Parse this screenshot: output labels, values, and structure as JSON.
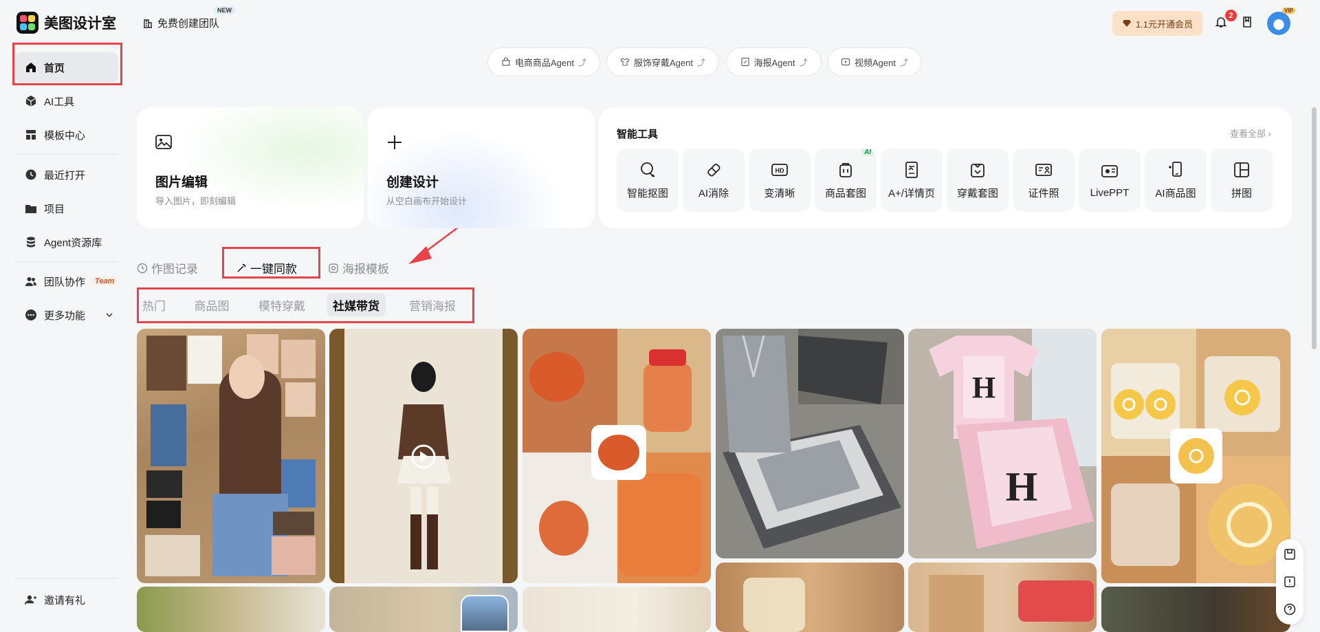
{
  "header": {
    "app_name": "美图设计室",
    "team_button": "免费创建团队",
    "new_badge": "NEW",
    "vip_button": "1.1元开通会员",
    "notification_count": "2",
    "avatar_badge": "VIP"
  },
  "sidebar": {
    "items": [
      {
        "label": "首页",
        "icon": "home-icon"
      },
      {
        "label": "AI工具",
        "icon": "cube-icon"
      },
      {
        "label": "模板中心",
        "icon": "layout-icon"
      },
      {
        "label": "最近打开",
        "icon": "clock-icon"
      },
      {
        "label": "项目",
        "icon": "folder-icon"
      },
      {
        "label": "Agent资源库",
        "icon": "database-icon"
      },
      {
        "label": "团队协作",
        "icon": "team-icon",
        "tag": "Team"
      },
      {
        "label": "更多功能",
        "icon": "more-icon"
      }
    ],
    "invite": "邀请有礼"
  },
  "agents": [
    {
      "label": "电商商品Agent",
      "icon": "bag-icon"
    },
    {
      "label": "服饰穿戴Agent",
      "icon": "shirt-icon"
    },
    {
      "label": "海报Agent",
      "icon": "poster-icon"
    },
    {
      "label": "视频Agent",
      "icon": "video-icon"
    }
  ],
  "cards": {
    "edit": {
      "title": "图片编辑",
      "subtitle": "导入图片，即刻编辑"
    },
    "create": {
      "title": "创建设计",
      "subtitle": "从空白画布开始设计"
    }
  },
  "tools": {
    "title": "智能工具",
    "view_all": "查看全部",
    "items": [
      {
        "label": "智能抠图",
        "icon": "cutout-icon"
      },
      {
        "label": "AI消除",
        "icon": "eraser-icon"
      },
      {
        "label": "变清晰",
        "icon": "hd-icon"
      },
      {
        "label": "商品套图",
        "icon": "product-set-icon",
        "tag": "AI"
      },
      {
        "label": "A+/详情页",
        "icon": "detail-page-icon"
      },
      {
        "label": "穿戴套图",
        "icon": "wear-set-icon"
      },
      {
        "label": "证件照",
        "icon": "id-photo-icon"
      },
      {
        "label": "LivePPT",
        "icon": "ppt-icon"
      },
      {
        "label": "AI商品图",
        "icon": "ai-product-icon"
      },
      {
        "label": "拼图",
        "icon": "collage-icon"
      }
    ]
  },
  "tabs": [
    {
      "label": "作图记录",
      "icon": "history-icon"
    },
    {
      "label": "一键同款",
      "icon": "magic-wand-icon",
      "active": true
    },
    {
      "label": "海报模板",
      "icon": "poster-template-icon"
    }
  ],
  "subtabs": [
    {
      "label": "热门"
    },
    {
      "label": "商品图"
    },
    {
      "label": "模特穿戴"
    },
    {
      "label": "社媒带货",
      "active": true
    },
    {
      "label": "营销海报"
    }
  ],
  "colors": {
    "accent_red": "#e8434c",
    "vip_bg": "#fde0c8",
    "ai_tag": "#1b8a4e"
  }
}
